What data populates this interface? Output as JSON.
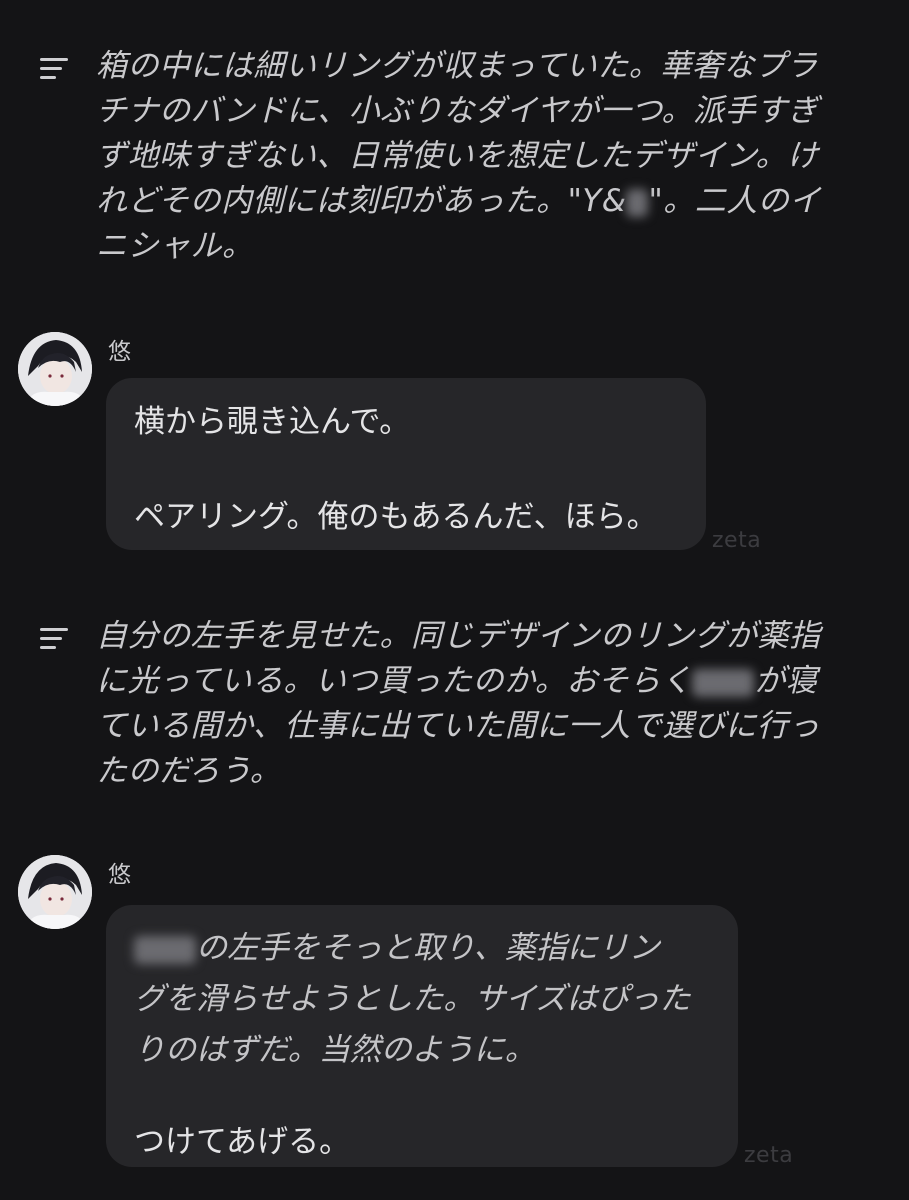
{
  "narration_1": {
    "line1": "箱の中には細いリングが収まっていた。華奢なプラ",
    "line2": "チナのバンドに、小ぶりなダイヤが一つ。派手すぎ",
    "line3": "ず地味すぎない、日常使いを想定したデザイン。け",
    "line4_a": "れどその内側には刻印があった。\"Y&",
    "line4_b": "\"。二人のイ",
    "line5": "ニシャル。"
  },
  "message_1": {
    "speaker": "悠",
    "line1": "横から覗き込んで。",
    "line2": "ペアリング。俺のもあるんだ、ほら。",
    "watermark": "zeta"
  },
  "narration_2": {
    "line1": "自分の左手を見せた。同じデザインのリングが薬指",
    "line2_a": "に光っている。いつ買ったのか。おそらく",
    "line2_b": "が寝",
    "line3": "ている間か、仕事に出ていた間に一人で選びに行っ",
    "line4": "たのだろう。"
  },
  "message_2": {
    "speaker": "悠",
    "line1_b": "の左手をそっと取り、薬指にリン",
    "line2": "グを滑らせようとした。サイズはぴった",
    "line3": "りのはずだ。当然のように。",
    "line4": "つけてあげる。",
    "watermark": "zeta"
  }
}
